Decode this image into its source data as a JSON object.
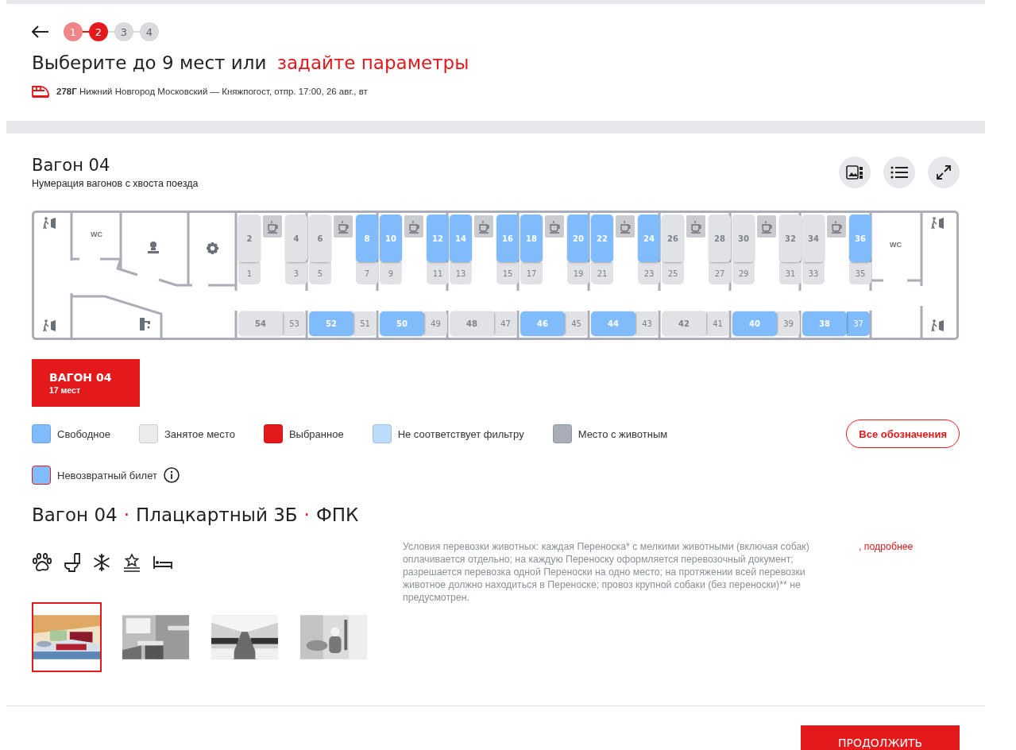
{
  "header": {
    "steps": [
      {
        "label": "1",
        "done": true,
        "current": false
      },
      {
        "label": "2",
        "done": false,
        "current": true
      },
      {
        "label": "3",
        "done": false,
        "current": false
      },
      {
        "label": "4",
        "done": false,
        "current": false
      }
    ],
    "title": "Выберите до 9 мест или",
    "title_link": "задайте параметры",
    "train_info": "**278Г** Нижний Новгород Московский — Княжпогост, отпр. 17:00, 26 авг., вт"
  },
  "car": {
    "title": "Вагон 04",
    "subtitle": "Нумерация вагонов с хвоста поезда",
    "map": {
      "left_wc": "WC",
      "right_wc": "WC",
      "blocks": [
        {
          "left": [
            {
              "number": "2",
              "free": false
            },
            {
              "number": "1",
              "free": false
            }
          ],
          "right": [
            {
              "number": "4",
              "free": false
            },
            {
              "number": "3",
              "free": false
            }
          ],
          "side": [
            {
              "number": "54",
              "free": false
            },
            {
              "number": "53",
              "free": false
            }
          ]
        },
        {
          "left": [
            {
              "number": "6",
              "free": false
            },
            {
              "number": "5",
              "free": false
            }
          ],
          "right": [
            {
              "number": "8",
              "free": true
            },
            {
              "number": "7",
              "free": false
            }
          ],
          "side": [
            {
              "number": "52",
              "free": true
            },
            {
              "number": "51",
              "free": false
            }
          ]
        },
        {
          "left": [
            {
              "number": "10",
              "free": true
            },
            {
              "number": "9",
              "free": false
            }
          ],
          "right": [
            {
              "number": "12",
              "free": true
            },
            {
              "number": "11",
              "free": false
            }
          ],
          "side": [
            {
              "number": "50",
              "free": true
            },
            {
              "number": "49",
              "free": false
            }
          ]
        },
        {
          "left": [
            {
              "number": "14",
              "free": true
            },
            {
              "number": "13",
              "free": false
            }
          ],
          "right": [
            {
              "number": "16",
              "free": true
            },
            {
              "number": "15",
              "free": false
            }
          ],
          "side": [
            {
              "number": "48",
              "free": false
            },
            {
              "number": "47",
              "free": false
            }
          ]
        },
        {
          "left": [
            {
              "number": "18",
              "free": true
            },
            {
              "number": "17",
              "free": false
            }
          ],
          "right": [
            {
              "number": "20",
              "free": true
            },
            {
              "number": "19",
              "free": false
            }
          ],
          "side": [
            {
              "number": "46",
              "free": true
            },
            {
              "number": "45",
              "free": false
            }
          ]
        },
        {
          "left": [
            {
              "number": "22",
              "free": true
            },
            {
              "number": "21",
              "free": false
            }
          ],
          "right": [
            {
              "number": "24",
              "free": true
            },
            {
              "number": "23",
              "free": false
            }
          ],
          "side": [
            {
              "number": "44",
              "free": true
            },
            {
              "number": "43",
              "free": false
            }
          ]
        },
        {
          "left": [
            {
              "number": "26",
              "free": false
            },
            {
              "number": "25",
              "free": false
            }
          ],
          "right": [
            {
              "number": "28",
              "free": false
            },
            {
              "number": "27",
              "free": false
            }
          ],
          "side": [
            {
              "number": "42",
              "free": false
            },
            {
              "number": "41",
              "free": false
            }
          ]
        },
        {
          "left": [
            {
              "number": "30",
              "free": false
            },
            {
              "number": "29",
              "free": false
            }
          ],
          "right": [
            {
              "number": "32",
              "free": false
            },
            {
              "number": "31",
              "free": false
            }
          ],
          "side": [
            {
              "number": "40",
              "free": true
            },
            {
              "number": "39",
              "free": false
            }
          ]
        },
        {
          "left": [
            {
              "number": "34",
              "free": false
            },
            {
              "number": "33",
              "free": false
            }
          ],
          "right": [
            {
              "number": "36",
              "free": true
            },
            {
              "number": "35",
              "free": false
            }
          ],
          "side": [
            {
              "number": "38",
              "free": true
            },
            {
              "number": "37",
              "free": true
            }
          ]
        }
      ]
    },
    "tabs": [
      {
        "label": "ВАГОН 04",
        "seats": "17 мест",
        "selected": true
      }
    ]
  },
  "legend": {
    "items": [
      {
        "label": "Свободное",
        "color": "#80bcfb",
        "kind": "plain"
      },
      {
        "label": "Занятое место",
        "color": "#e9ebed",
        "kind": "plain"
      },
      {
        "label": "Выбранное",
        "color": "#e3191b",
        "kind": "plain"
      },
      {
        "label": "Не соответствует фильтру",
        "color": "#bcdcfc",
        "kind": "plain"
      },
      {
        "label": "Место с животным",
        "color": "#a9adb8",
        "kind": "plain"
      },
      {
        "label": "Невозвратный билет",
        "color": "#80bcfb",
        "kind": "nonrefund"
      }
    ],
    "all_button": "Все обозначения"
  },
  "details": {
    "heading": [
      "Вагон 04",
      "Плацкартный 3Б",
      "ФПК"
    ],
    "separator": "·",
    "pet_text": "Условия перевозки животных: каждая Переноска* с мелкими животными (включая собак) оплачивается отдельно; на каждую Переноску оформляется перевозочный документ; разрешается перевозка одной Переноски на одно место; на протяжении всей перевозки животное должно находиться в Переноске; провоз крупной собаки (без переноски)** не предусмотрен.",
    "pet_link": ", подробнее",
    "photos": [
      {
        "selected": true
      },
      {
        "selected": false
      },
      {
        "selected": false
      },
      {
        "selected": false
      }
    ]
  },
  "continue_button": "ПРОДОЛЖИТЬ"
}
